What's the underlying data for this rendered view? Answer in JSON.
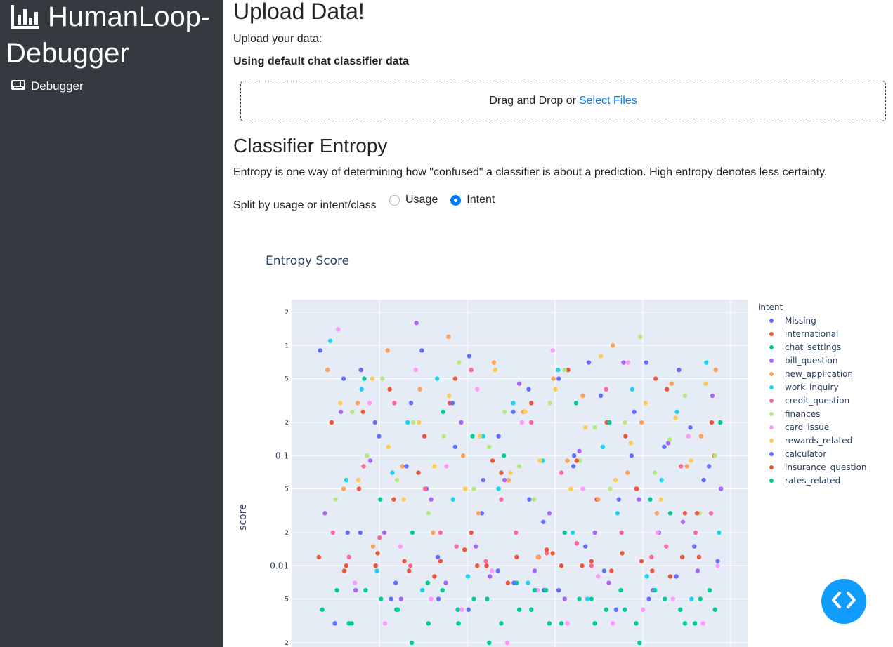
{
  "sidebar": {
    "title": "HumanLoop-Debugger",
    "title_icon": "bar-chart-icon",
    "nav": [
      {
        "label": "Debugger",
        "icon": "keyboard-icon"
      }
    ]
  },
  "upload": {
    "heading": "Upload Data!",
    "prompt": "Upload your data:",
    "status": "Using default chat classifier data",
    "drop_text": "Drag and Drop or",
    "select_link": "Select Files"
  },
  "entropy": {
    "heading": "Classifier Entropy",
    "description": "Entropy is one way of determining how \"confused\" a classifier is about a prediction. High entropy denotes less certainty.",
    "split_label": "Split by usage or intent/class",
    "options": [
      {
        "label": "Usage",
        "selected": false
      },
      {
        "label": "Intent",
        "selected": true
      }
    ]
  },
  "chart_data": {
    "type": "scatter",
    "title": "Entropy Score",
    "ylabel": "score",
    "xlabel": "",
    "yscale": "log",
    "y_ticks": [
      {
        "value": 0.002,
        "label": "2"
      },
      {
        "value": 0.005,
        "label": "5"
      },
      {
        "value": 0.01,
        "label": "0.01"
      },
      {
        "value": 0.02,
        "label": "2"
      },
      {
        "value": 0.05,
        "label": "5"
      },
      {
        "value": 0.1,
        "label": "0.1"
      },
      {
        "value": 0.2,
        "label": "2"
      },
      {
        "value": 0.5,
        "label": "5"
      },
      {
        "value": 1,
        "label": "1"
      },
      {
        "value": 2,
        "label": "2"
      }
    ],
    "grid": true,
    "legend_title": "intent",
    "legend_position": "right",
    "series": [
      {
        "name": "Missing",
        "color": "#636efa",
        "x": [
          5,
          27,
          46,
          66,
          93,
          118,
          141,
          164,
          182,
          207,
          228,
          247,
          271,
          294,
          318,
          340,
          362,
          384,
          402,
          425,
          448,
          471,
          493,
          512,
          538,
          559,
          579,
          600
        ],
        "y": [
          0.9,
          0.003,
          0.02,
          0.6,
          0.15,
          0.007,
          0.3,
          0.05,
          0.005,
          0.12,
          0.8,
          0.03,
          0.009,
          0.25,
          0.04,
          0.006,
          0.5,
          0.08,
          0.015,
          0.35,
          0.004,
          0.1,
          0.7,
          0.02,
          0.008,
          0.18,
          0.06,
          0.011
        ]
      },
      {
        "name": "international",
        "color": "#ef553b",
        "x": [
          3,
          22,
          41,
          63,
          88,
          109,
          131,
          152,
          176,
          199,
          221,
          240,
          263,
          286,
          309,
          332,
          353,
          376,
          397,
          419,
          441,
          462,
          486,
          507,
          529,
          551,
          572,
          595
        ],
        "y": [
          0.012,
          0.2,
          0.009,
          0.05,
          0.01,
          0.4,
          0.011,
          0.07,
          0.008,
          0.3,
          0.014,
          0.01,
          0.09,
          0.007,
          0.25,
          0.012,
          0.013,
          0.6,
          0.01,
          0.04,
          0.009,
          0.15,
          0.011,
          0.5,
          0.008,
          0.03,
          0.012,
          0.1
        ]
      },
      {
        "name": "chat_settings",
        "color": "#00cc96",
        "x": [
          8,
          30,
          52,
          71,
          96,
          121,
          143,
          167,
          188,
          211,
          233,
          255,
          276,
          299,
          321,
          343,
          366,
          388,
          411,
          433,
          455,
          478,
          499,
          521,
          544,
          566,
          588,
          604
        ],
        "y": [
          0.004,
          0.006,
          0.003,
          0.5,
          0.005,
          0.004,
          0.02,
          0.003,
          0.006,
          0.004,
          0.15,
          0.005,
          0.003,
          0.007,
          0.004,
          0.006,
          0.003,
          0.3,
          0.005,
          0.004,
          0.006,
          0.003,
          0.04,
          0.005,
          0.004,
          0.003,
          0.006,
          0.2
        ]
      },
      {
        "name": "bill_question",
        "color": "#ab63fa",
        "x": [
          12,
          36,
          58,
          80,
          101,
          126,
          149,
          171,
          193,
          216,
          238,
          259,
          281,
          303,
          326,
          348,
          371,
          393,
          416,
          437,
          459,
          482,
          503,
          526,
          548,
          570,
          592,
          605
        ],
        "y": [
          0.03,
          0.25,
          0.006,
          0.09,
          0.02,
          0.005,
          1.6,
          0.04,
          0.007,
          0.2,
          0.015,
          0.008,
          0.06,
          0.45,
          0.009,
          0.03,
          0.005,
          0.11,
          0.02,
          0.007,
          0.7,
          0.04,
          0.006,
          0.13,
          0.025,
          0.009,
          0.35,
          0.05
        ]
      },
      {
        "name": "new_application",
        "color": "#ffa15a",
        "x": [
          16,
          40,
          61,
          84,
          106,
          128,
          154,
          174,
          197,
          219,
          242,
          265,
          287,
          309,
          331,
          354,
          375,
          398,
          421,
          443,
          465,
          486,
          509,
          531,
          554,
          575,
          597
        ],
        "y": [
          0.6,
          0.05,
          0.3,
          0.015,
          0.9,
          0.08,
          0.4,
          0.02,
          1.2,
          0.1,
          0.03,
          0.7,
          0.06,
          0.25,
          0.012,
          0.5,
          0.09,
          0.35,
          0.04,
          1.0,
          0.07,
          0.2,
          0.03,
          0.45,
          0.08,
          0.15,
          0.6
        ]
      },
      {
        "name": "work_inquiry",
        "color": "#19d3f3",
        "x": [
          20,
          44,
          67,
          90,
          113,
          136,
          158,
          180,
          204,
          226,
          249,
          272,
          294,
          316,
          338,
          361,
          383,
          405,
          428,
          450,
          472,
          494,
          516,
          539,
          561,
          583,
          602
        ],
        "y": [
          1.1,
          0.06,
          0.4,
          0.009,
          0.07,
          0.2,
          0.006,
          0.5,
          0.04,
          0.008,
          0.15,
          0.05,
          0.3,
          0.007,
          0.09,
          0.6,
          0.02,
          0.005,
          0.12,
          0.03,
          0.4,
          0.008,
          0.06,
          0.25,
          0.005,
          0.7,
          0.02
        ]
      },
      {
        "name": "credit_question",
        "color": "#ff6692",
        "x": [
          24,
          48,
          70,
          94,
          116,
          140,
          162,
          185,
          209,
          231,
          253,
          276,
          298,
          321,
          344,
          366,
          389,
          411,
          433,
          456,
          478,
          501,
          523,
          545,
          567,
          590
        ],
        "y": [
          0.02,
          0.012,
          0.08,
          0.018,
          0.3,
          0.01,
          0.05,
          0.02,
          0.015,
          0.6,
          0.011,
          0.04,
          0.02,
          0.2,
          0.013,
          0.07,
          0.016,
          0.01,
          0.4,
          0.02,
          0.05,
          0.012,
          0.015,
          0.08,
          0.02,
          0.03
        ]
      },
      {
        "name": "finances",
        "color": "#b6e880",
        "x": [
          28,
          53,
          75,
          98,
          120,
          144,
          167,
          190,
          213,
          235,
          258,
          281,
          303,
          325,
          349,
          371,
          394,
          416,
          439,
          461,
          484,
          506,
          528,
          551,
          573,
          596
        ],
        "y": [
          0.04,
          0.25,
          0.1,
          0.5,
          0.06,
          0.2,
          0.03,
          0.15,
          0.7,
          0.05,
          0.12,
          0.25,
          0.08,
          0.04,
          0.3,
          0.6,
          0.09,
          0.18,
          0.05,
          0.2,
          1.2,
          0.07,
          0.14,
          0.35,
          0.03,
          0.1
        ]
      },
      {
        "name": "card_issue",
        "color": "#ff97ff",
        "x": [
          32,
          57,
          79,
          102,
          125,
          148,
          171,
          194,
          217,
          240,
          262,
          285,
          307,
          330,
          353,
          375,
          398,
          421,
          443,
          466,
          488,
          510,
          533,
          556,
          578,
          600
        ],
        "y": [
          1.4,
          0.007,
          0.3,
          0.003,
          0.015,
          0.6,
          0.005,
          0.08,
          0.004,
          0.4,
          0.009,
          0.002,
          0.2,
          0.006,
          0.9,
          0.003,
          0.05,
          0.008,
          0.003,
          0.7,
          0.004,
          0.02,
          0.005,
          0.15,
          0.003,
          0.01
        ]
      },
      {
        "name": "rewards_related",
        "color": "#fecb52",
        "x": [
          35,
          62,
          83,
          107,
          130,
          153,
          176,
          198,
          222,
          244,
          267,
          290,
          312,
          334,
          357,
          380,
          402,
          425,
          447,
          470,
          492,
          515,
          537,
          560,
          582
        ],
        "y": [
          0.3,
          0.06,
          0.5,
          0.12,
          0.04,
          0.2,
          0.08,
          0.35,
          0.05,
          0.15,
          0.6,
          0.07,
          0.25,
          0.09,
          0.4,
          0.05,
          0.18,
          0.8,
          0.06,
          0.13,
          0.3,
          0.04,
          0.22,
          0.09,
          0.45
        ]
      },
      {
        "name": "calculator",
        "color": "#636efa",
        "x": [
          40,
          65,
          87,
          111,
          134,
          157,
          181,
          203,
          227,
          249,
          272,
          295,
          317,
          339,
          362,
          385,
          407,
          430,
          452,
          475,
          497,
          520,
          542,
          565,
          587
        ],
        "y": [
          0.5,
          0.02,
          0.2,
          0.005,
          0.08,
          0.9,
          0.012,
          0.3,
          0.004,
          0.06,
          0.15,
          0.007,
          0.4,
          0.025,
          0.006,
          0.1,
          0.7,
          0.009,
          0.04,
          0.25,
          0.005,
          0.12,
          0.6,
          0.015,
          0.08
        ]
      },
      {
        "name": "insurance_question",
        "color": "#ef553b",
        "x": [
          44,
          69,
          91,
          115,
          138,
          161,
          185,
          207,
          231,
          254,
          276,
          299,
          321,
          344,
          366,
          389,
          411,
          434,
          457,
          479,
          502,
          524,
          547,
          569,
          591
        ],
        "y": [
          0.01,
          0.25,
          0.013,
          0.04,
          0.009,
          0.15,
          0.011,
          0.5,
          0.02,
          0.01,
          0.07,
          0.012,
          0.3,
          0.014,
          0.01,
          0.09,
          0.011,
          0.2,
          0.013,
          0.05,
          0.009,
          0.4,
          0.012,
          0.03,
          0.2
        ]
      },
      {
        "name": "rates_related",
        "color": "#00cc96",
        "x": [
          48,
          73,
          95,
          119,
          142,
          166,
          189,
          212,
          235,
          258,
          280,
          303,
          326,
          348,
          371,
          393,
          416,
          438,
          461,
          483,
          506,
          529,
          551,
          574,
          596
        ],
        "y": [
          0.003,
          0.006,
          0.04,
          0.004,
          0.002,
          0.007,
          0.25,
          0.003,
          0.005,
          0.002,
          0.1,
          0.004,
          0.006,
          0.003,
          0.02,
          0.005,
          0.003,
          0.2,
          0.004,
          0.002,
          0.006,
          0.03,
          0.003,
          0.005,
          0.004
        ]
      }
    ]
  }
}
